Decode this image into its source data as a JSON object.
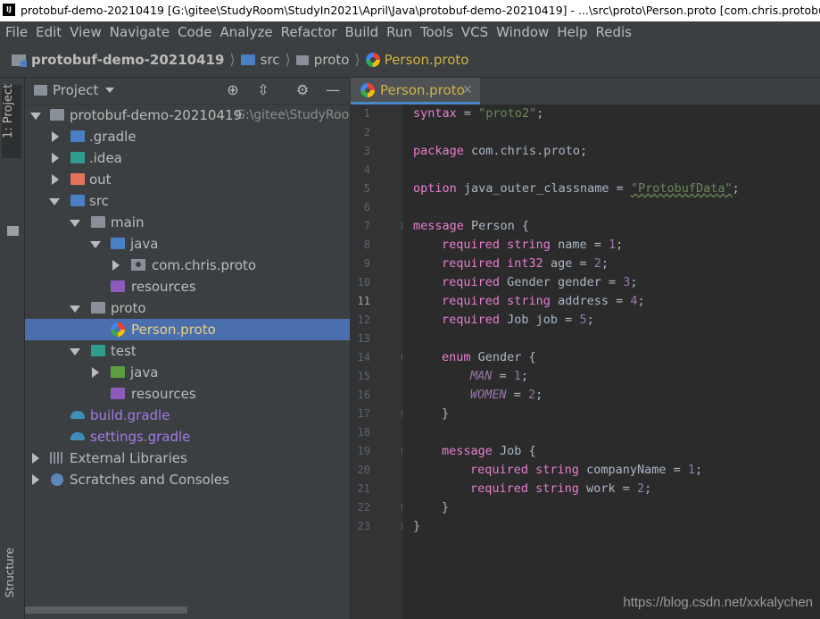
{
  "window": {
    "title": "protobuf-demo-20210419 [G:\\gitee\\StudyRoom\\StudyIn2021\\April\\Java\\protobuf-demo-20210419] - ...\\src\\proto\\Person.proto [com.chris.protobuf-demo",
    "app_icon": "IJ"
  },
  "menu": [
    "File",
    "Edit",
    "View",
    "Navigate",
    "Code",
    "Analyze",
    "Refactor",
    "Build",
    "Run",
    "Tools",
    "VCS",
    "Window",
    "Help",
    "Redis"
  ],
  "breadcrumb": {
    "project": "protobuf-demo-20210419",
    "src": "src",
    "proto": "proto",
    "file": "Person.proto"
  },
  "left_stripe": {
    "project_tab": "1: Project",
    "bottom_tab": "Structure"
  },
  "project_panel": {
    "title": "Project",
    "tree": [
      {
        "label": "protobuf-demo-20210419",
        "path": "G:\\gitee\\StudyRoom"
      },
      {
        "label": ".gradle"
      },
      {
        "label": ".idea"
      },
      {
        "label": "out"
      },
      {
        "label": "src"
      },
      {
        "label": "main"
      },
      {
        "label": "java"
      },
      {
        "label": "com.chris.proto"
      },
      {
        "label": "resources"
      },
      {
        "label": "proto"
      },
      {
        "label": "Person.proto"
      },
      {
        "label": "test"
      },
      {
        "label": "java"
      },
      {
        "label": "resources"
      },
      {
        "label": "build.gradle"
      },
      {
        "label": "settings.gradle"
      },
      {
        "label": "External Libraries"
      },
      {
        "label": "Scratches and Consoles"
      }
    ]
  },
  "editor": {
    "tab_label": "Person.proto",
    "current_line": 11,
    "line_numbers": [
      "1",
      "2",
      "3",
      "4",
      "5",
      "6",
      "7",
      "8",
      "9",
      "10",
      "11",
      "12",
      "13",
      "14",
      "15",
      "16",
      "17",
      "18",
      "19",
      "20",
      "21",
      "22",
      "23"
    ],
    "code": {
      "l1_kw": "syntax",
      "l1_eq": " = ",
      "l1_str": "\"proto2\"",
      "l1_end": ";",
      "l3_kw": "package",
      "l3_rest": " com.chris.proto;",
      "l5_kw": "option",
      "l5_mid": " java_outer_classname = ",
      "l5_str": "\"ProtobufData\"",
      "l5_end": ";",
      "l7_kw": "message",
      "l7_rest": " Person {",
      "l8_kw": "required",
      "l8_type": "string",
      "l8_rest": " name = ",
      "l8_num": "1",
      "l8_end": ";",
      "l9_kw": "required",
      "l9_type": "int32",
      "l9_rest": " age = ",
      "l9_num": "2",
      "l9_end": ";",
      "l10_kw": "required",
      "l10_rest": " Gender gender = ",
      "l10_num": "3",
      "l10_end": ";",
      "l11_kw": "required",
      "l11_type": "string",
      "l11_rest": " address = ",
      "l11_num": "4",
      "l11_end": ";",
      "l12_kw": "required",
      "l12_rest": " Job job = ",
      "l12_num": "5",
      "l12_end": ";",
      "l14_kw": "enum",
      "l14_rest": " Gender {",
      "l15_const": "MAN",
      "l15_rest": " = ",
      "l15_num": "1",
      "l15_end": ";",
      "l16_const": "WOMEN",
      "l16_rest": " = ",
      "l16_num": "2",
      "l16_end": ";",
      "l17": "}",
      "l19_kw": "message",
      "l19_rest": " Job {",
      "l20_kw": "required",
      "l20_type": "string",
      "l20_rest": " companyName = ",
      "l20_num": "1",
      "l20_end": ";",
      "l21_kw": "required",
      "l21_type": "string",
      "l21_rest": " work = ",
      "l21_num": "2",
      "l21_end": ";",
      "l22": "}",
      "l23": "}"
    }
  },
  "watermark": "https://blog.csdn.net/xxkalychen",
  "colors": {
    "keyword": "#e77ed0",
    "string": "#6a8759",
    "number": "#9876aa",
    "selection": "#4b6eaf",
    "gradle_text": "#a07be4",
    "folder_blue": "#4a7fc4"
  }
}
